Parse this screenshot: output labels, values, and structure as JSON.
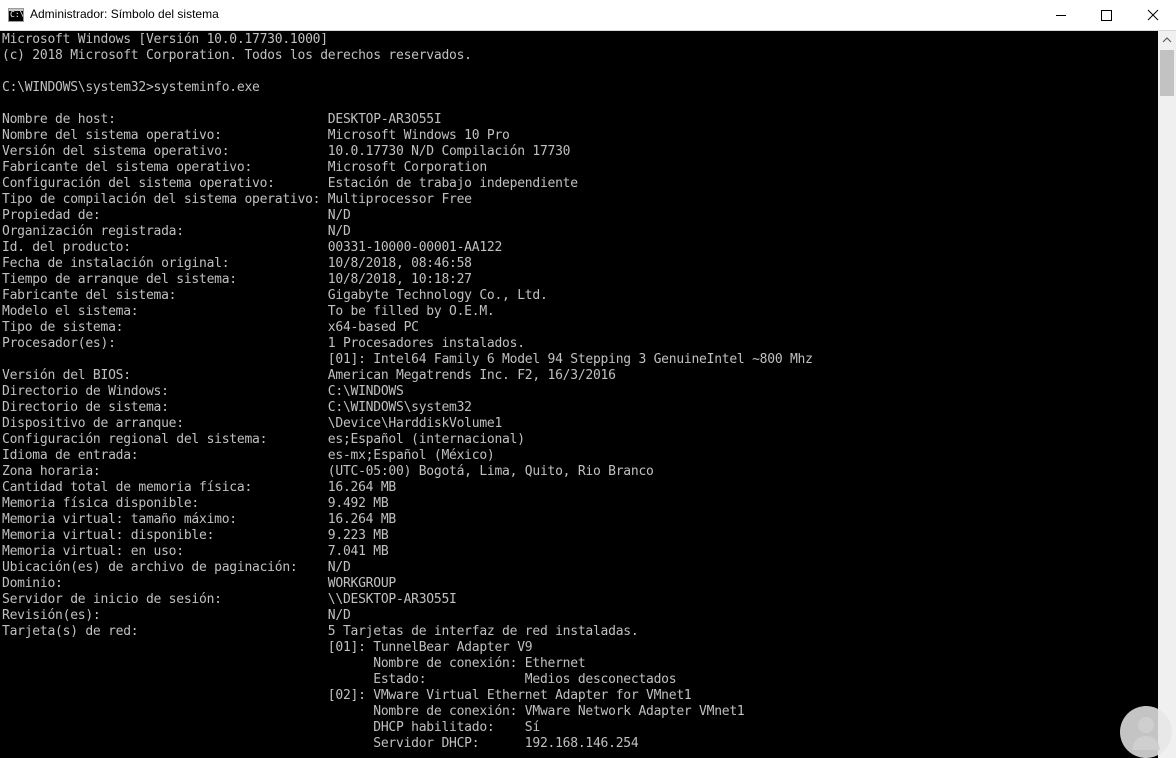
{
  "window": {
    "title": "Administrador: Símbolo del sistema",
    "icon": "console-icon",
    "icon_glyph": "C:\\",
    "controls": [
      "minimize-icon",
      "maximize-icon",
      "close-icon"
    ]
  },
  "console": {
    "text_color": "#c0c0c0",
    "background": "#000000",
    "lines": [
      "Microsoft Windows [Versión 10.0.17730.1000]",
      "(c) 2018 Microsoft Corporation. Todos los derechos reservados.",
      "",
      "C:\\WINDOWS\\system32>systeminfo.exe",
      "",
      "Nombre de host:                            DESKTOP-AR3O55I",
      "Nombre del sistema operativo:              Microsoft Windows 10 Pro",
      "Versión del sistema operativo:             10.0.17730 N/D Compilación 17730",
      "Fabricante del sistema operativo:          Microsoft Corporation",
      "Configuración del sistema operativo:       Estación de trabajo independiente",
      "Tipo de compilación del sistema operativo: Multiprocessor Free",
      "Propiedad de:                              N/D",
      "Organización registrada:                   N/D",
      "Id. del producto:                          00331-10000-00001-AA122",
      "Fecha de instalación original:             10/8/2018, 08:46:58",
      "Tiempo de arranque del sistema:            10/8/2018, 10:18:27",
      "Fabricante del sistema:                    Gigabyte Technology Co., Ltd.",
      "Modelo el sistema:                         To be filled by O.E.M.",
      "Tipo de sistema:                           x64-based PC",
      "Procesador(es):                            1 Procesadores instalados.",
      "                                           [01]: Intel64 Family 6 Model 94 Stepping 3 GenuineIntel ~800 Mhz",
      "Versión del BIOS:                          American Megatrends Inc. F2, 16/3/2016",
      "Directorio de Windows:                     C:\\WINDOWS",
      "Directorio de sistema:                     C:\\WINDOWS\\system32",
      "Dispositivo de arranque:                   \\Device\\HarddiskVolume1",
      "Configuración regional del sistema:        es;Español (internacional)",
      "Idioma de entrada:                         es-mx;Español (México)",
      "Zona horaria:                              (UTC-05:00) Bogotá, Lima, Quito, Rio Branco",
      "Cantidad total de memoria física:          16.264 MB",
      "Memoria física disponible:                 9.492 MB",
      "Memoria virtual: tamaño máximo:            16.264 MB",
      "Memoria virtual: disponible:               9.223 MB",
      "Memoria virtual: en uso:                   7.041 MB",
      "Ubicación(es) de archivo de paginación:    N/D",
      "Dominio:                                   WORKGROUP",
      "Servidor de inicio de sesión:              \\\\DESKTOP-AR3O55I",
      "Revisión(es):                              N/D",
      "Tarjeta(s) de red:                         5 Tarjetas de interfaz de red instaladas.",
      "                                           [01]: TunnelBear Adapter V9",
      "                                                 Nombre de conexión: Ethernet",
      "                                                 Estado:             Medios desconectados",
      "                                           [02]: VMware Virtual Ethernet Adapter for VMnet1",
      "                                                 Nombre de conexión: VMware Network Adapter VMnet1",
      "                                                 DHCP habilitado:    Sí",
      "                                                 Servidor DHCP:      192.168.146.254"
    ]
  },
  "scrollbar": {
    "up_arrow": "scroll-up-arrow-icon"
  }
}
